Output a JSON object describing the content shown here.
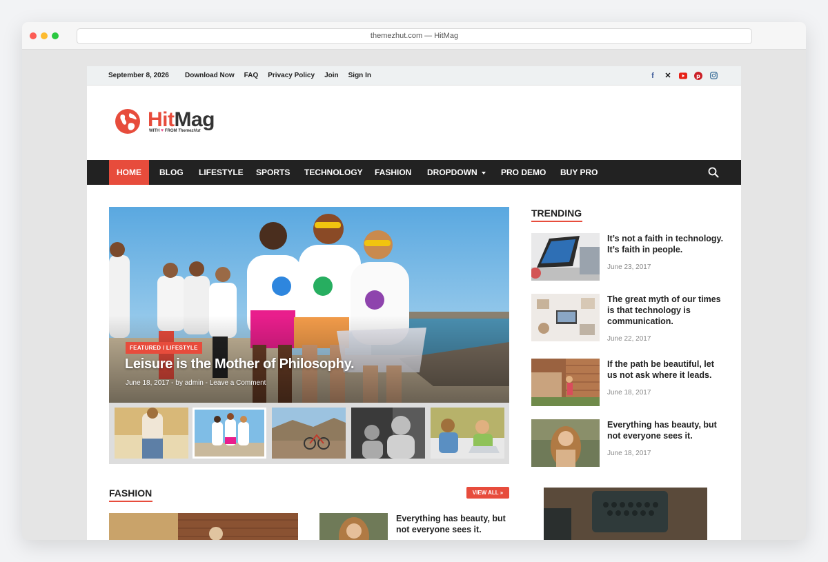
{
  "browser": {
    "url": "themezhut.com — HitMag"
  },
  "topbar": {
    "date": "September 8, 2026",
    "links": [
      "Download Now",
      "FAQ",
      "Privacy Policy",
      "Join",
      "Sign In"
    ],
    "social_icons": [
      "facebook-icon",
      "x-icon",
      "youtube-icon",
      "pinterest-icon",
      "instagram-icon"
    ]
  },
  "logo": {
    "name_part1": "Hit",
    "name_part2": "Mag",
    "tagline_with": "WITH",
    "tagline_from": "FROM",
    "tagline_brand": "ThemezHut"
  },
  "nav": {
    "items": [
      "HOME",
      "BLOG",
      "LIFESTYLE",
      "SPORTS",
      "TECHNOLOGY",
      "FASHION",
      "DROPDOWN",
      "PRO DEMO",
      "BUY PRO"
    ],
    "active_index": 0
  },
  "hero": {
    "category": "FEATURED / LIFESTYLE",
    "title": "Leisure is the Mother of Philosophy.",
    "date": "June 18, 2017",
    "author": "by admin",
    "comments": "Leave a Comment"
  },
  "trending": {
    "heading": "TRENDING",
    "posts": [
      {
        "title": "It’s not a faith in technology. It’s faith in people.",
        "date": "June 23, 2017"
      },
      {
        "title": "The great myth of our times is that technology is communication.",
        "date": "June 22, 2017"
      },
      {
        "title": "If the path be beautiful, let us not ask where it leads.",
        "date": "June 18, 2017"
      },
      {
        "title": "Everything has beauty, but not everyone sees it.",
        "date": "June 18, 2017"
      }
    ]
  },
  "fashion": {
    "heading": "FASHION",
    "view_all": "VIEW ALL »",
    "post_title": "Everything has beauty, but not everyone sees it."
  },
  "colors": {
    "accent": "#e74c3c",
    "nav_bg": "#222222",
    "topbar_bg": "#eef1f2"
  }
}
